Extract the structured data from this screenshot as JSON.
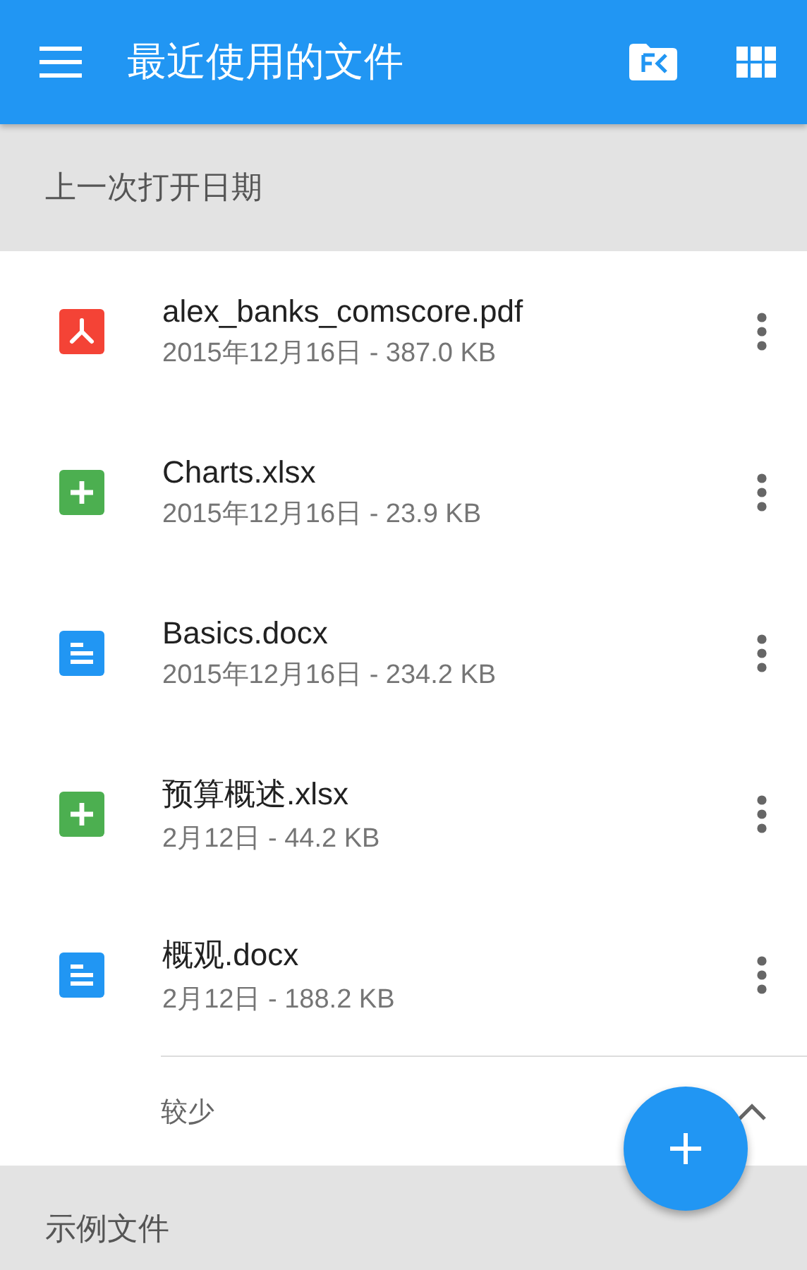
{
  "app_bar": {
    "title": "最近使用的文件"
  },
  "sections": [
    {
      "title": "上一次打开日期",
      "files": [
        {
          "kind": "pdf",
          "name": "alex_banks_comscore.pdf",
          "meta": "2015年12月16日 - 387.0 KB"
        },
        {
          "kind": "sheet",
          "name": "Charts.xlsx",
          "meta": "2015年12月16日 - 23.9 KB"
        },
        {
          "kind": "doc",
          "name": "Basics.docx",
          "meta": "2015年12月16日 - 234.2 KB"
        },
        {
          "kind": "sheet",
          "name": "预算概述.xlsx",
          "meta": "2月12日 - 44.2 KB"
        },
        {
          "kind": "doc",
          "name": "概观.docx",
          "meta": "2月12日 - 188.2 KB"
        }
      ],
      "toggle": {
        "label": "较少",
        "expanded": true
      }
    },
    {
      "title": "示例文件"
    }
  ]
}
